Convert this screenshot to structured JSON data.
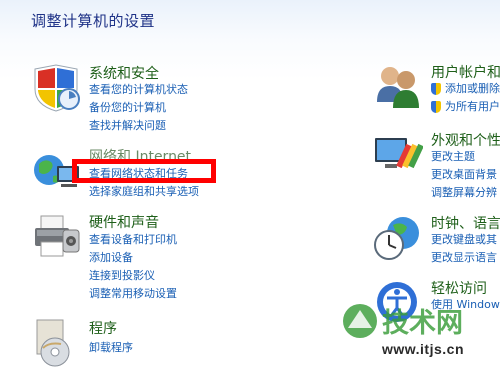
{
  "page_title": "调整计算机的设置",
  "left": {
    "system": {
      "title": "系统和安全",
      "links": [
        "查看您的计算机状态",
        "备份您的计算机",
        "查找并解决问题"
      ]
    },
    "network": {
      "title": "网络和 Internet",
      "links": [
        "查看网络状态和任务",
        "选择家庭组和共享选项"
      ]
    },
    "hardware": {
      "title": "硬件和声音",
      "links": [
        "查看设备和打印机",
        "添加设备",
        "连接到投影仪",
        "调整常用移动设置"
      ]
    },
    "programs": {
      "title": "程序",
      "links": [
        "卸载程序"
      ]
    }
  },
  "right": {
    "users": {
      "title": "用户帐户和",
      "links": [
        "添加或删除",
        "为所有用户"
      ]
    },
    "appearance": {
      "title": "外观和个性",
      "links": [
        "更改主题",
        "更改桌面背景",
        "调整屏幕分辨"
      ]
    },
    "clock": {
      "title": "时钟、语言",
      "links": [
        "更改键盘或其",
        "更改显示语言"
      ]
    },
    "ease": {
      "title": "轻松访问",
      "links": [
        "使用 Windows"
      ]
    }
  },
  "watermark": {
    "logo_text": "技术网",
    "url": "www.itjs.cn"
  },
  "colors": {
    "title": "#1e3287",
    "category_title": "#1e5f19",
    "link": "#1a5fb4",
    "highlight": "#ff0000"
  }
}
